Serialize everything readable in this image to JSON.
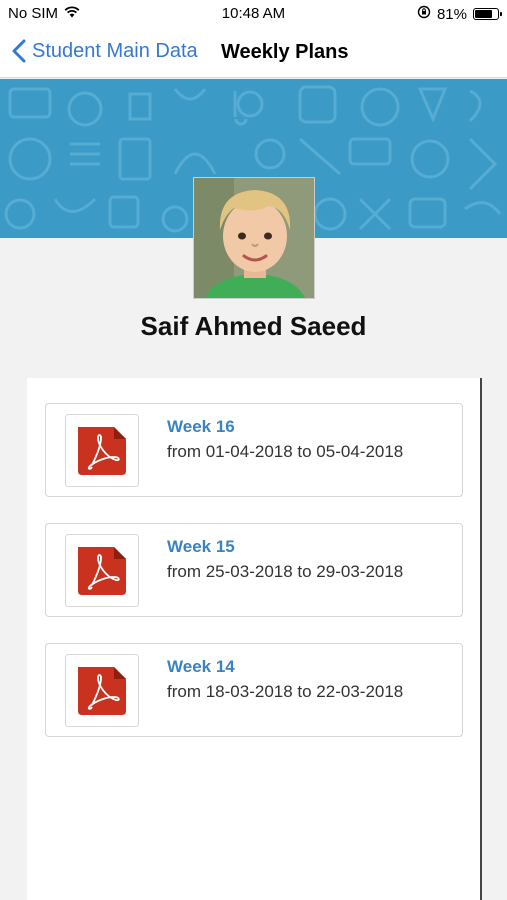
{
  "status_bar": {
    "carrier": "No SIM",
    "time": "10:48 AM",
    "battery_percent": "81%",
    "battery_level": 0.81,
    "icons": [
      "wifi-icon",
      "orientation-lock-icon",
      "battery-icon"
    ]
  },
  "nav": {
    "back_label": "Student Main Data",
    "title": "Weekly Plans",
    "back_icon": "chevron-left-icon"
  },
  "colors": {
    "accent": "#3478d6",
    "banner": "#3b9ac6",
    "week_title": "#3a82c4",
    "pdf_red": "#c8321f"
  },
  "student": {
    "name": "Saif Ahmed Saeed"
  },
  "plans": [
    {
      "title": "Week 16",
      "range": "from 01-04-2018 to 05-04-2018",
      "icon": "pdf-icon"
    },
    {
      "title": "Week 15",
      "range": "from 25-03-2018 to 29-03-2018",
      "icon": "pdf-icon"
    },
    {
      "title": "Week 14",
      "range": "from 18-03-2018 to 22-03-2018",
      "icon": "pdf-icon"
    }
  ]
}
